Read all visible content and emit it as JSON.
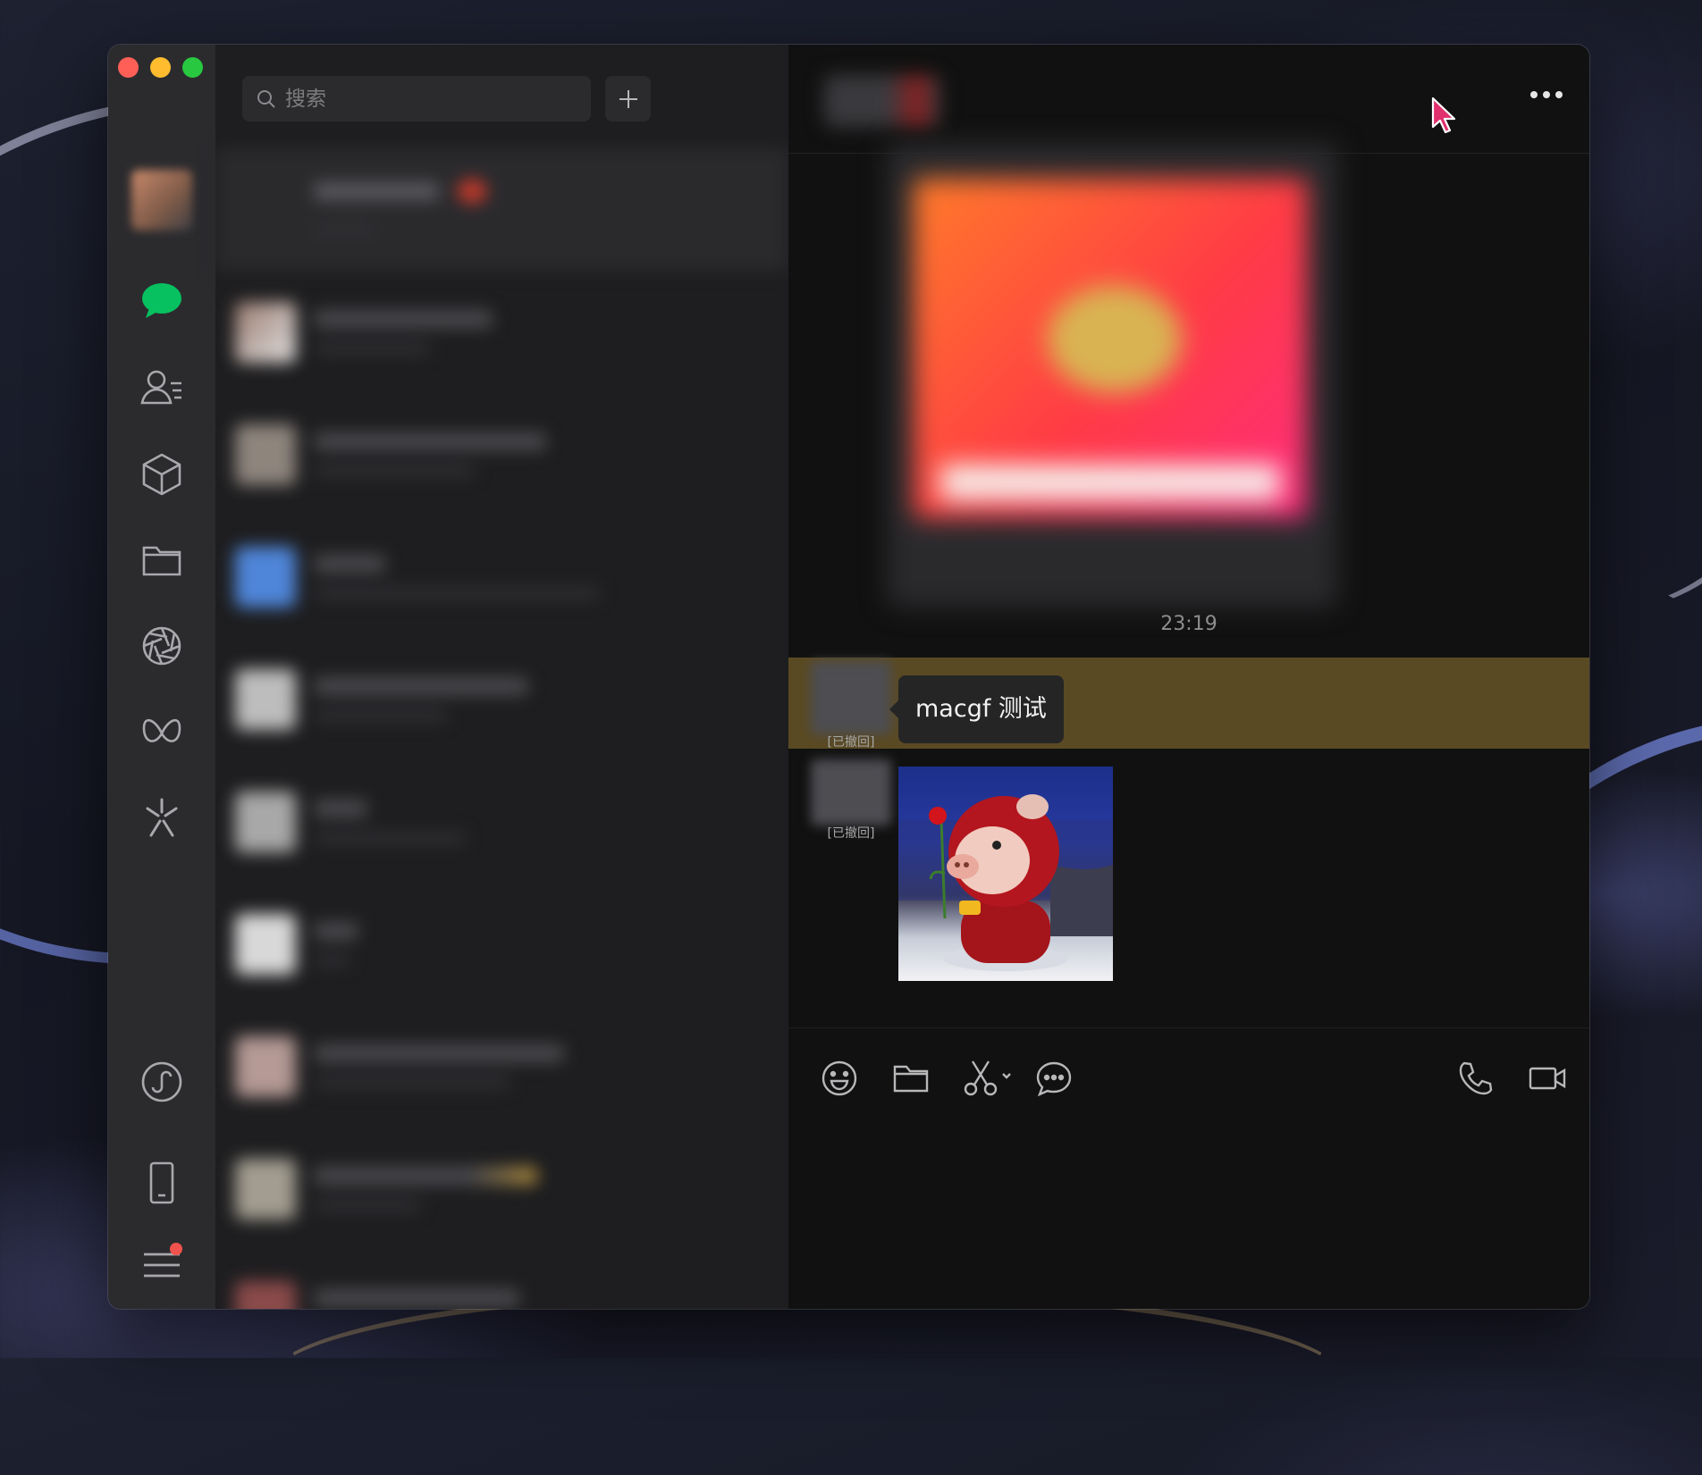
{
  "search": {
    "placeholder": "搜索"
  },
  "chat": {
    "timestamp": "23:19",
    "messages": [
      {
        "text": "macgf 测试",
        "status": "[已撤回]"
      },
      {
        "status": "[已撤回]",
        "sticker": "pig-with-rose"
      }
    ]
  },
  "colors": {
    "accent_green": "#07c160",
    "highlight_row": "#5a4a23",
    "badge_red": "#f0524d"
  },
  "icons": {
    "rail": [
      "chat-icon",
      "contacts-icon",
      "favorites-icon",
      "files-icon",
      "moments-icon",
      "channels-icon",
      "search-spark-icon",
      "mini-programs-icon",
      "phone-device-icon",
      "menu-icon"
    ],
    "toolbar": [
      "emoji-icon",
      "folder-icon",
      "scissors-icon",
      "chat-history-icon",
      "voice-call-icon",
      "video-call-icon"
    ],
    "header": [
      "more-icon"
    ]
  }
}
